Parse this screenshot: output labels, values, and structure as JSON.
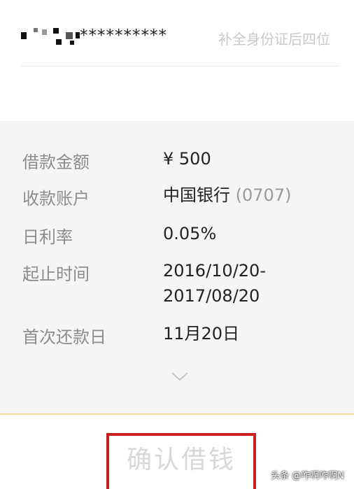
{
  "identity": {
    "masked_number": "**********",
    "placeholder": "补全身份证后四位"
  },
  "loan": {
    "rows": [
      {
        "label": "借款金额",
        "value": "¥ 500"
      },
      {
        "label": "收款账户",
        "value": "中国银行",
        "sub": "(0707)"
      },
      {
        "label": "日利率",
        "value": "0.05%"
      },
      {
        "label": "起止时间",
        "value": "2016/10/20-",
        "value2": "2017/08/20"
      },
      {
        "label": "首次还款日",
        "value": "11月20日"
      }
    ],
    "expand_icon": "chevron-down-icon"
  },
  "confirm": {
    "label": "确认借钱"
  },
  "watermark": "头条 @咋啊咋啊N",
  "colors": {
    "highlight_border": "#c71f1f",
    "accent_line": "#f0d9a4",
    "panel_bg": "#f5f5f5"
  }
}
